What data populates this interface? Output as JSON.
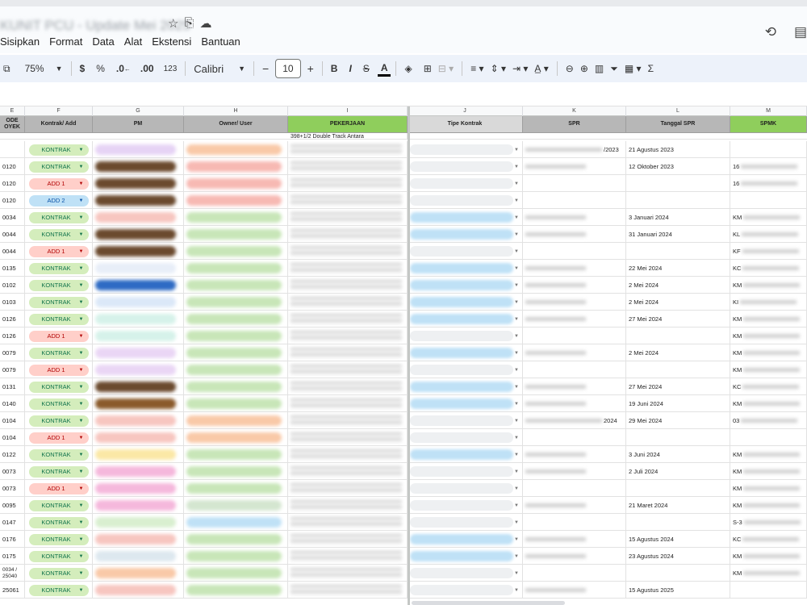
{
  "doc_title": "KUNIT PCU - Update Mei 2025",
  "menu": [
    "Sisipkan",
    "Format",
    "Data",
    "Alat",
    "Ekstensi",
    "Bantuan"
  ],
  "toolbar": {
    "zoom": "75%",
    "currency": "$",
    "percent": "%",
    "dec_decrease": ".0←",
    "dec_increase": ".00",
    "number_format": "123",
    "font": "Calibri",
    "font_size": "10",
    "minus": "−",
    "plus": "+",
    "bold": "B",
    "italic": "I",
    "strike": "S",
    "text_color": "A",
    "sum": "Σ"
  },
  "columns": [
    {
      "letter": "E",
      "header": "ODE\nOYEK"
    },
    {
      "letter": "F",
      "header": "Kontrak/ Add"
    },
    {
      "letter": "G",
      "header": "PM"
    },
    {
      "letter": "H",
      "header": "Owner/ User"
    },
    {
      "letter": "I",
      "header": "PEKERJAAN"
    },
    {
      "letter": "J",
      "header": "Tipe Kontrak"
    },
    {
      "letter": "K",
      "header": "SPR"
    },
    {
      "letter": "L",
      "header": "Tanggal SPR"
    },
    {
      "letter": "M",
      "header": "SPMK"
    }
  ],
  "first_row_text": "398+1/2 Double Track Antara",
  "rows": [
    {
      "kode": "",
      "kontrak": "KONTRAK",
      "pm_color": "#e6d3f5",
      "owner_color": "#f9c9a8",
      "j": "",
      "k_suffix": "/2023",
      "tanggal": "21 Agustus 2023",
      "spmk": ""
    },
    {
      "kode": "0120",
      "kontrak": "KONTRAK",
      "pm_color": "#6b4a2e",
      "owner_color": "#f7b9b3",
      "j": "",
      "k_suffix": "",
      "tanggal": "12 Oktober 2023",
      "spmk": "16"
    },
    {
      "kode": "0120",
      "kontrak": "ADD 1",
      "pm_color": "#6b4a2e",
      "owner_color": "#f7b9b3",
      "j": "",
      "k_suffix": "",
      "tanggal": "",
      "spmk": "16"
    },
    {
      "kode": "0120",
      "kontrak": "ADD 2",
      "pm_color": "#6b4a2e",
      "owner_color": "#f7b9b3",
      "j": "",
      "k_suffix": "",
      "tanggal": "",
      "spmk": ""
    },
    {
      "kode": "0034",
      "kontrak": "KONTRAK",
      "pm_color": "#f7c6c0",
      "owner_color": "#c8e6b8",
      "j": "blue",
      "k_suffix": "",
      "tanggal": "3 Januari 2024",
      "spmk": "KM"
    },
    {
      "kode": "0044",
      "kontrak": "KONTRAK",
      "pm_color": "#6b4a2e",
      "owner_color": "#c8e6b8",
      "j": "blue",
      "k_suffix": "",
      "tanggal": "31 Januari 2024",
      "spmk": "KL"
    },
    {
      "kode": "0044",
      "kontrak": "ADD 1",
      "pm_color": "#6b4a2e",
      "owner_color": "#c8e6b8",
      "j": "",
      "k_suffix": "",
      "tanggal": "",
      "spmk": "KF"
    },
    {
      "kode": "0135",
      "kontrak": "KONTRAK",
      "pm_color": "#e8eef8",
      "owner_color": "#c8e6b8",
      "j": "blue",
      "k_suffix": "",
      "tanggal": "22 Mei 2024",
      "spmk": "KC"
    },
    {
      "kode": "0102",
      "kontrak": "KONTRAK",
      "pm_color": "#2e6bc4",
      "owner_color": "#c8e6b8",
      "j": "blue",
      "k_suffix": "",
      "tanggal": "2 Mei 2024",
      "spmk": "KM"
    },
    {
      "kode": "0103",
      "kontrak": "KONTRAK",
      "pm_color": "#dbe8f8",
      "owner_color": "#c8e6b8",
      "j": "blue",
      "k_suffix": "",
      "tanggal": "2 Mei 2024",
      "spmk": "KI"
    },
    {
      "kode": "0126",
      "kontrak": "KONTRAK",
      "pm_color": "#d6f2ea",
      "owner_color": "#c8e6b8",
      "j": "blue",
      "k_suffix": "",
      "tanggal": "27 Mei 2024",
      "spmk": "KM"
    },
    {
      "kode": "0126",
      "kontrak": "ADD 1",
      "pm_color": "#d6f2ea",
      "owner_color": "#c8e6b8",
      "j": "",
      "k_suffix": "",
      "tanggal": "",
      "spmk": "KM"
    },
    {
      "kode": "0079",
      "kontrak": "KONTRAK",
      "pm_color": "#ead6f5",
      "owner_color": "#c8e6b8",
      "j": "blue",
      "k_suffix": "",
      "tanggal": "2 Mei 2024",
      "spmk": "KM"
    },
    {
      "kode": "0079",
      "kontrak": "ADD 1",
      "pm_color": "#ead6f5",
      "owner_color": "#c8e6b8",
      "j": "",
      "k_suffix": "",
      "tanggal": "",
      "spmk": "KM"
    },
    {
      "kode": "0131",
      "kontrak": "KONTRAK",
      "pm_color": "#6b4a2e",
      "owner_color": "#c8e6b8",
      "j": "blue",
      "k_suffix": "",
      "tanggal": "27 Mei 2024",
      "spmk": "KC"
    },
    {
      "kode": "0140",
      "kontrak": "KONTRAK",
      "pm_color": "#8a5a2b",
      "owner_color": "#c8e6b8",
      "j": "blue",
      "k_suffix": "",
      "tanggal": "19 Juni 2024",
      "spmk": "KM"
    },
    {
      "kode": "0104",
      "kontrak": "KONTRAK",
      "pm_color": "#f7c6c0",
      "owner_color": "#f9c9a8",
      "j": "",
      "k_suffix": "2024",
      "tanggal": "29 Mei 2024",
      "spmk": "03"
    },
    {
      "kode": "0104",
      "kontrak": "ADD 1",
      "pm_color": "#f7c6c0",
      "owner_color": "#f9c9a8",
      "j": "",
      "k_suffix": "",
      "tanggal": "",
      "spmk": ""
    },
    {
      "kode": "0122",
      "kontrak": "KONTRAK",
      "pm_color": "#fbe8a6",
      "owner_color": "#c8e6b8",
      "j": "blue",
      "k_suffix": "",
      "tanggal": "3 Juni 2024",
      "spmk": "KM"
    },
    {
      "kode": "0073",
      "kontrak": "KONTRAK",
      "pm_color": "#f5b8dc",
      "owner_color": "#c8e6b8",
      "j": "",
      "k_suffix": "",
      "tanggal": "2 Juli 2024",
      "spmk": "KM"
    },
    {
      "kode": "0073",
      "kontrak": "ADD 1",
      "pm_color": "#f5b8dc",
      "owner_color": "#c8e6b8",
      "j": "",
      "k_suffix": "",
      "tanggal": "",
      "spmk": "KM"
    },
    {
      "kode": "0095",
      "kontrak": "KONTRAK",
      "pm_color": "#f5b8dc",
      "owner_color": "#d4e6d0",
      "j": "",
      "k_suffix": "",
      "tanggal": "21 Maret 2024",
      "spmk": "KM"
    },
    {
      "kode": "0147",
      "kontrak": "KONTRAK",
      "pm_color": "#d9efd0",
      "owner_color": "#bfe1f6",
      "j": "",
      "k_suffix": "",
      "tanggal": "",
      "spmk": "S-3"
    },
    {
      "kode": "0176",
      "kontrak": "KONTRAK",
      "pm_color": "#f7c6c0",
      "owner_color": "#c8e6b8",
      "j": "blue",
      "k_suffix": "",
      "tanggal": "15 Agustus 2024",
      "spmk": "KC"
    },
    {
      "kode": "0175",
      "kontrak": "KONTRAK",
      "pm_color": "#dde8ef",
      "owner_color": "#c8e6b8",
      "j": "blue",
      "k_suffix": "",
      "tanggal": "23 Agustus 2024",
      "spmk": "KM"
    },
    {
      "kode": "0034 /\n25040",
      "kontrak": "KONTRAK",
      "pm_color": "#f9c9a8",
      "owner_color": "#c8e6b8",
      "j": "",
      "k_suffix": "",
      "tanggal": "",
      "spmk": "KM"
    },
    {
      "kode": "25061",
      "kontrak": "KONTRAK",
      "pm_color": "#f7c6c0",
      "owner_color": "#c8e6b8",
      "j": "",
      "k_suffix": "",
      "tanggal": "15 Agustus 2025",
      "spmk": ""
    }
  ],
  "colors": {
    "header_gray": "#b7b7b7",
    "header_green": "#8fce5c",
    "kontrak_chip": "#d4edbc",
    "add1_chip": "#ffcfc9",
    "add2_chip": "#bfe1f6"
  }
}
